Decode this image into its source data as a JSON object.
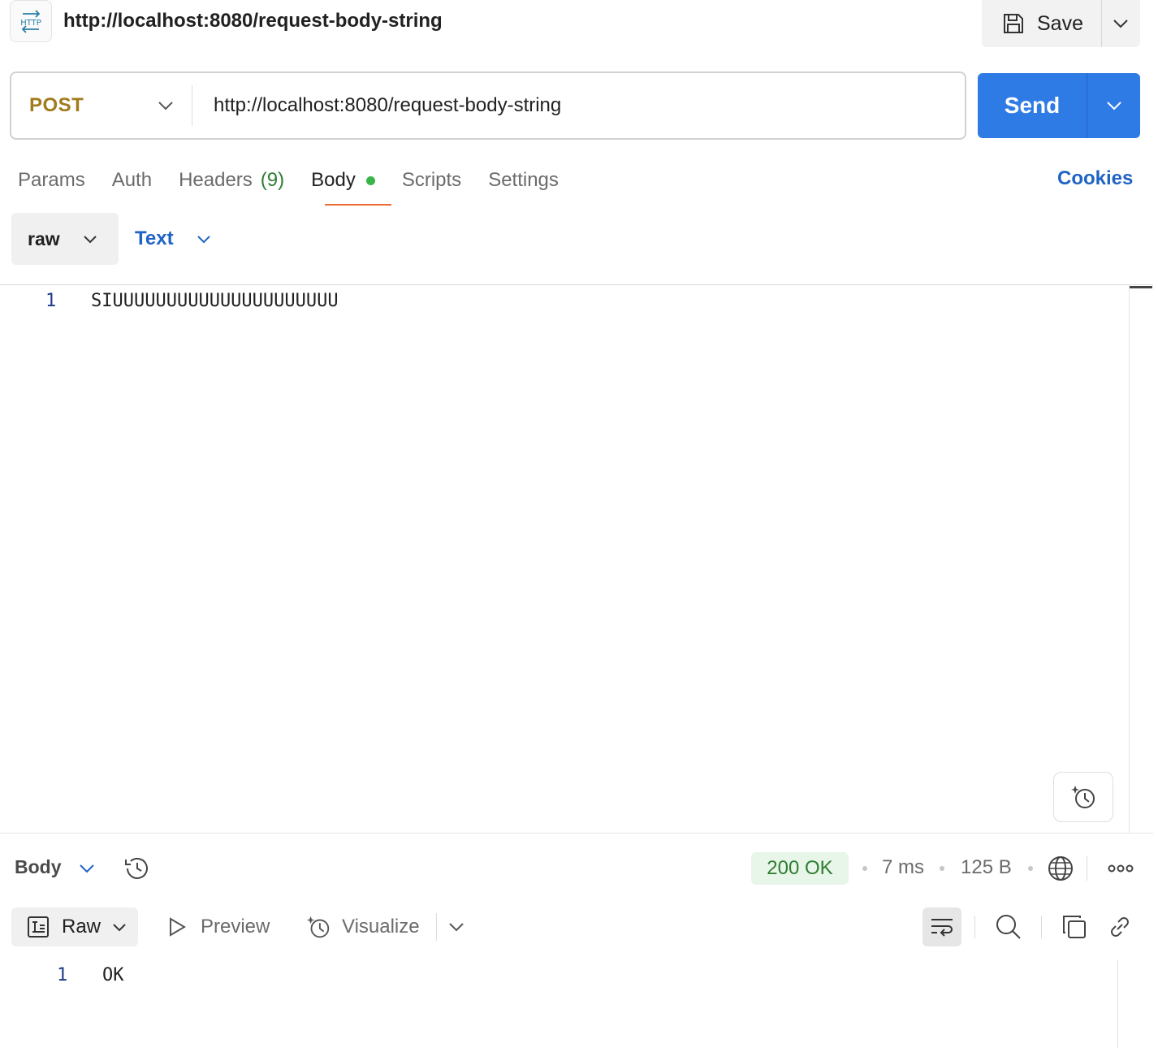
{
  "header": {
    "request_title": "http://localhost:8080/request-body-string",
    "http_badge": "HTTP",
    "save_label": "Save"
  },
  "url_bar": {
    "method": "POST",
    "url": "http://localhost:8080/request-body-string",
    "send_label": "Send"
  },
  "tabs": {
    "params": "Params",
    "auth": "Auth",
    "headers": "Headers",
    "headers_count": "(9)",
    "body": "Body",
    "scripts": "Scripts",
    "settings": "Settings",
    "active": "Body",
    "cookies": "Cookies"
  },
  "body_options": {
    "mode": "raw",
    "format": "Text"
  },
  "editor": {
    "line_number": "1",
    "content": "SIUUUUUUUUUUUUUUUUUUUUU"
  },
  "response": {
    "section_label": "Body",
    "status": "200 OK",
    "time": "7 ms",
    "size": "125 B",
    "view_mode": "Raw",
    "preview_label": "Preview",
    "visualize_label": "Visualize",
    "line_number": "1",
    "content": "OK"
  },
  "colors": {
    "method": "#a17a1c",
    "send": "#2f7be5",
    "link": "#1f63c4",
    "active_tab_underline": "#ee6a33",
    "status_ok": "#2e7d32"
  }
}
